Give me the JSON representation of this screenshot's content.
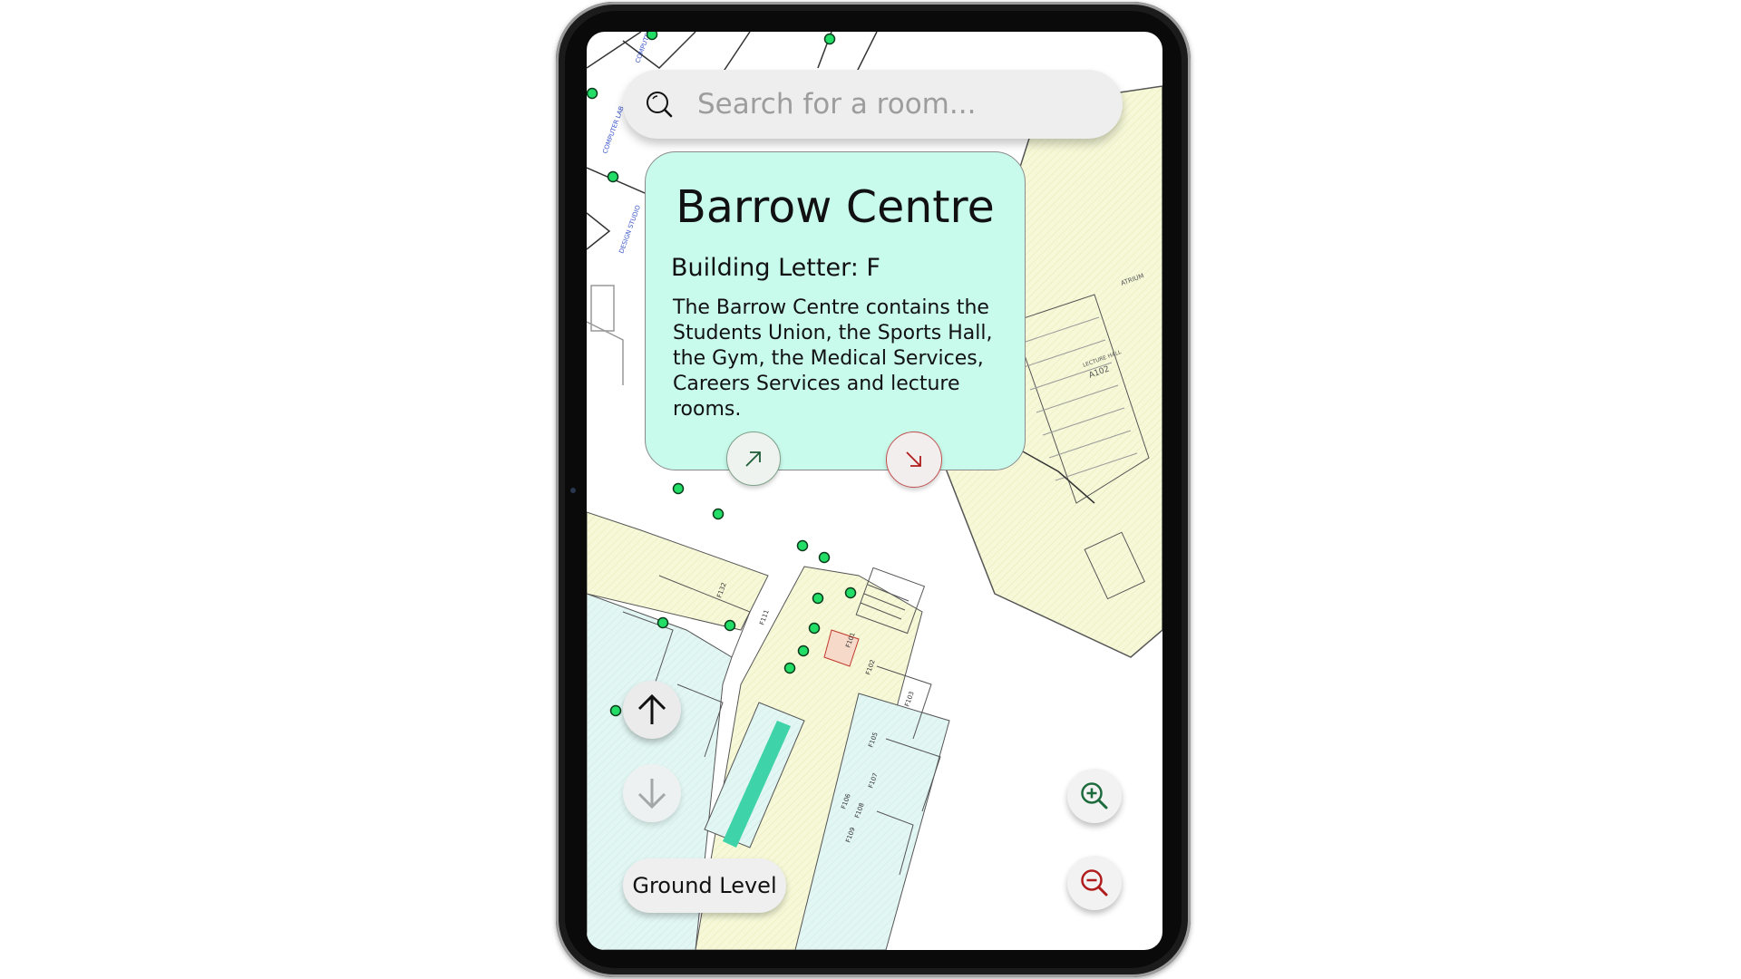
{
  "search": {
    "placeholder": "Search for a room..."
  },
  "popup": {
    "title": "Barrow Centre",
    "building_letter": "Building Letter: F",
    "description": "The Barrow Centre contains the Students Union, the Sports Hall, the Gym, the Medical Services, Careers Services and  lecture rooms."
  },
  "floor": {
    "current_level": "Ground Level"
  },
  "colors": {
    "popup_bg": "#c9fbec",
    "room_marker": "#22dd66",
    "entrance_marker": "#1e7be0",
    "zoom_in": "#1d6b3c",
    "zoom_out": "#b01c1c"
  },
  "icons": {
    "search": "search-icon",
    "route_start": "arrow-up-right-icon",
    "route_end": "arrow-down-right-icon",
    "level_up": "arrow-up-icon",
    "level_down": "arrow-down-icon",
    "zoom_in": "zoom-in-icon",
    "zoom_out": "zoom-out-icon"
  },
  "map_labels": {
    "room_f101": "F101",
    "room_f102": "F102",
    "room_f103": "F103",
    "room_f105": "F105",
    "room_f106": "F106",
    "room_f107": "F107",
    "room_f108": "F108",
    "room_f109": "F109",
    "room_f111": "F111",
    "room_f132": "F132",
    "lecture_hall": "LECTURE HALL",
    "room_a102": "A102",
    "computer_lab": "COMPUTER LAB",
    "design_studio": "DESIGN STUDIO",
    "atrium": "ATRIUM"
  }
}
